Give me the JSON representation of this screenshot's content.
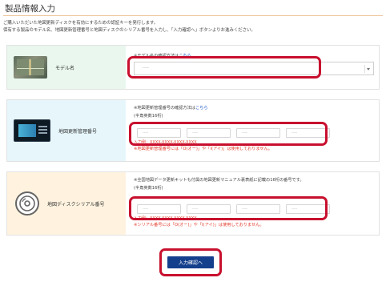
{
  "page": {
    "title": "製品情報入力",
    "intro_line1": "ご購入いただいた地図更新ディスクを有効にするための認証キーを発行します。",
    "intro_line2": "保有する製品のモデル名、地図更新管理番号と地図ディスクのシリアル番号を入力し、「入力確認へ」ボタンよりお進みください。"
  },
  "model_section": {
    "label": "モデル名",
    "note_prefix": "※モデル名の確認方法は",
    "note_link": "こちら",
    "select_value": "----"
  },
  "update_section": {
    "label": "地図更新管理番号",
    "note_prefix": "※地図更新管理番号の確認方法は",
    "note_link": "こちら",
    "sub_note": "(半角英数16桁)",
    "box_placeholder": "----",
    "example": "入力例：XXXX-XXXX-XXXX-XXXX",
    "error": "※地図更新管理番号には「O(オー)」や「I(アイ)」は使用しておりません。"
  },
  "serial_section": {
    "label": "地図ディスクシリアル番号",
    "note": "※全国地図データ更新キットも付属の地図更新マニュアル裏表紙に記載の16桁の番号です。",
    "sub_note": "(半角英数16桁)",
    "box_placeholder": "----",
    "example": "入力例：XXXX-XXXX-XXXX-XXXX",
    "error": "※シリアル番号には「O(オー)」や「I(アイ)」は使用しておりません。"
  },
  "actions": {
    "confirm_label": "入力確認へ"
  },
  "colors": {
    "accent_blue": "#143f8c",
    "highlight_red": "#c8102e",
    "error_red": "#e23a2a"
  }
}
